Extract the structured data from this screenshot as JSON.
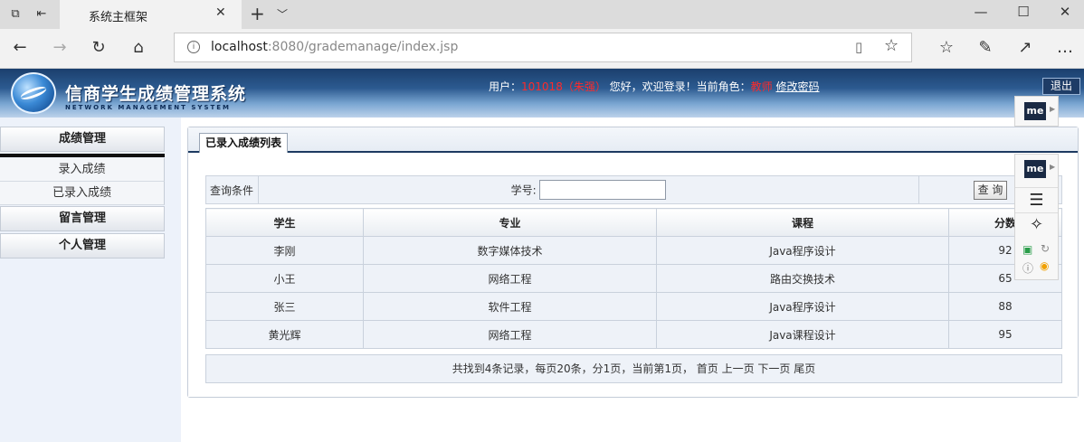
{
  "browser": {
    "tab_title": "系统主框架",
    "url_host": "localhost",
    "url_path": ":8080/grademanage/index.jsp"
  },
  "header": {
    "system_title": "信商学生成绩管理系统",
    "system_subtitle": "NETWORK MANAGEMENT SYSTEM",
    "user_label": "用户：",
    "user_id": "101018（朱强）",
    "greeting": "您好，欢迎登录！当前角色：",
    "role": "教师",
    "change_password": "修改密码",
    "logout": "退出"
  },
  "sidebar": {
    "sections": [
      {
        "label": "成绩管理",
        "items": [
          "录入成绩",
          "已录入成绩"
        ]
      },
      {
        "label": "留言管理",
        "items": []
      },
      {
        "label": "个人管理",
        "items": []
      }
    ]
  },
  "main": {
    "tab_label": "已录入成绩列表",
    "query_label": "查询条件",
    "student_id_label": "学号:",
    "student_id_value": "",
    "search_button": "查 询",
    "columns": [
      "学生",
      "专业",
      "课程",
      "分数"
    ],
    "rows": [
      {
        "student": "李刚",
        "major": "数字媒体技术",
        "course": "Java程序设计",
        "score": "92"
      },
      {
        "student": "小王",
        "major": "网络工程",
        "course": "路由交换技术",
        "score": "65"
      },
      {
        "student": "张三",
        "major": "软件工程",
        "course": "Java程序设计",
        "score": "88"
      },
      {
        "student": "黄光辉",
        "major": "网络工程",
        "course": "Java课程设计",
        "score": "95"
      }
    ],
    "pager": "共找到4条记录，每页20条，分1页，当前第1页， 首页 上一页 下一页 尾页"
  },
  "extension": {
    "label": "me"
  }
}
